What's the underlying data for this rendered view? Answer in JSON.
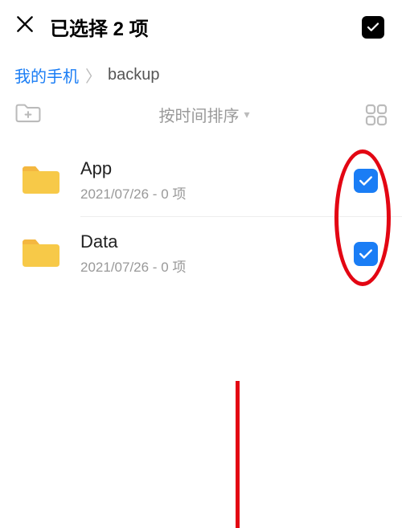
{
  "header": {
    "title": "已选择 2 项"
  },
  "breadcrumb": {
    "root": "我的手机",
    "current": "backup"
  },
  "toolbar": {
    "sort_label": "按时间排序"
  },
  "items": [
    {
      "name": "App",
      "meta": "2021/07/26 - 0 项"
    },
    {
      "name": "Data",
      "meta": "2021/07/26 - 0 项"
    }
  ]
}
